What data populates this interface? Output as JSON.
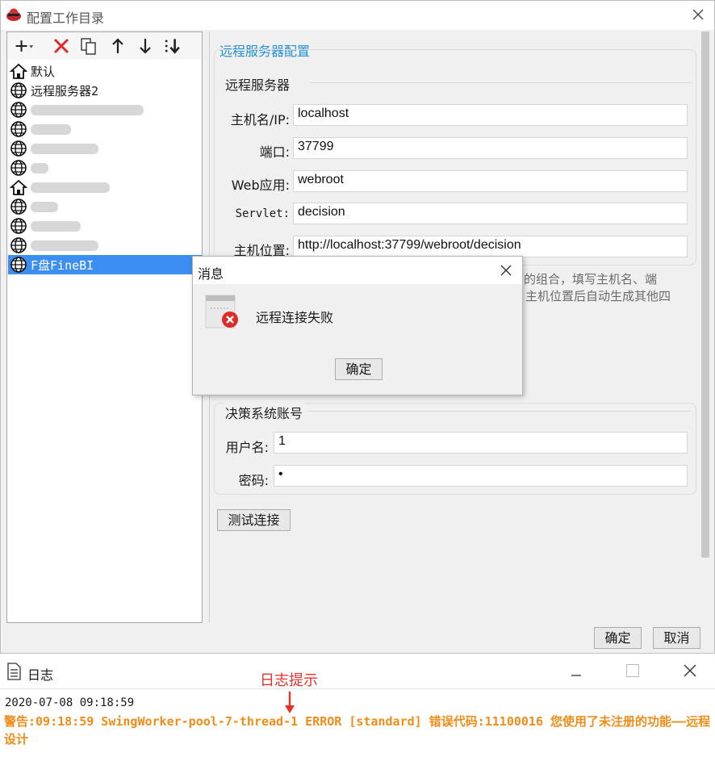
{
  "dialog": {
    "title": "配置工作目录",
    "ok_label": "确定",
    "cancel_label": "取消"
  },
  "toolbar": {
    "icons": [
      "plus-dropdown-icon",
      "delete-icon",
      "copy-icon",
      "move-up-icon",
      "move-down-icon",
      "sort-icon"
    ]
  },
  "tree": {
    "items": [
      {
        "label": "默认",
        "icon": "home-icon"
      },
      {
        "label": "远程服务器2",
        "icon": "globe-icon"
      },
      {
        "label": "",
        "icon": "globe-icon"
      },
      {
        "label": "",
        "icon": "globe-icon"
      },
      {
        "label": "",
        "icon": "globe-icon"
      },
      {
        "label": "",
        "icon": "globe-icon"
      },
      {
        "label": "",
        "icon": "home-icon"
      },
      {
        "label": "",
        "icon": "globe-icon"
      },
      {
        "label": "",
        "icon": "globe-icon"
      },
      {
        "label": "",
        "icon": "globe-icon"
      },
      {
        "label": "F盘FineBI",
        "icon": "globe-icon"
      }
    ],
    "selected_index": 10
  },
  "config": {
    "section_title": "远程服务器配置",
    "server_group_title": "远程服务器",
    "host_label": "主机名/IP:",
    "host_value": "localhost",
    "port_label": "端口:",
    "port_value": "37799",
    "webapp_label": "Web应用:",
    "webapp_value": "webroot",
    "servlet_label": "Servlet:",
    "servlet_value": "decision",
    "location_label": "主机位置:",
    "location_value": "http://localhost:37799/webroot/decision",
    "hint_line1": "的组合，填写主机名、端",
    "hint_line2": "主机位置后自动生成其他四",
    "account_group_title": "决策系统账号",
    "user_label": "用户名:",
    "user_value": "1",
    "password_label": "密码:",
    "password_value": "•",
    "test_button": "测试连接"
  },
  "message": {
    "title": "消息",
    "text": "远程连接失败",
    "ok_label": "确定"
  },
  "log": {
    "title": "日志",
    "annotation": "日志提示",
    "timestamp": "2020-07-08 09:18:59",
    "warning": "警告:09:18:59 SwingWorker-pool-7-thread-1 ERROR [standard] 错误代码:11100016 您使用了未注册的功能——远程设计"
  },
  "colors": {
    "accent": "#1d8fd8",
    "selection": "#3c8ff0",
    "error": "#e02a2a",
    "warning_text": "#f08c18",
    "annotation": "#e8302a"
  }
}
